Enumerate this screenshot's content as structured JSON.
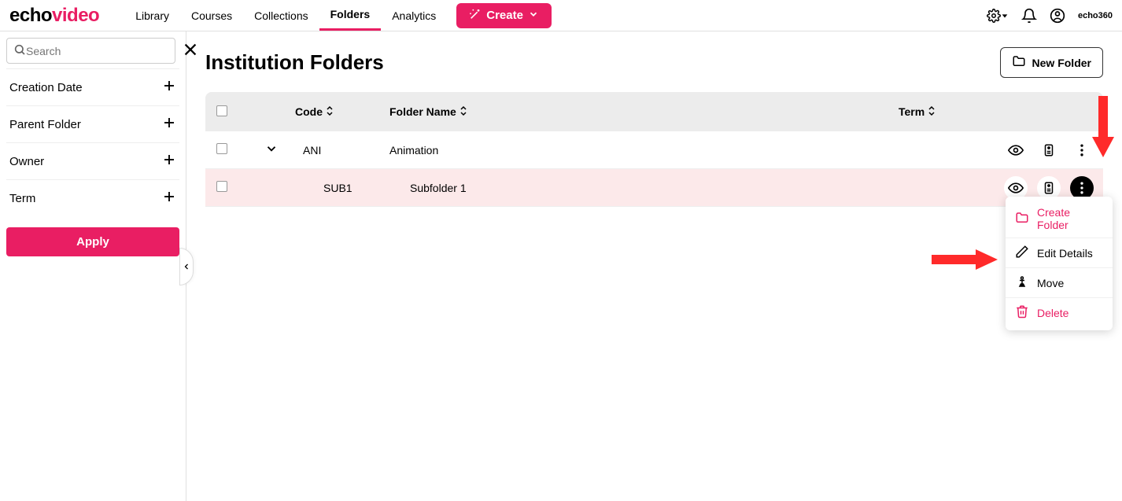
{
  "logo": {
    "echo": "echo",
    "video": "video"
  },
  "nav": {
    "items": [
      {
        "label": "Library"
      },
      {
        "label": "Courses"
      },
      {
        "label": "Collections"
      },
      {
        "label": "Folders"
      },
      {
        "label": "Analytics"
      }
    ],
    "create_label": "Create"
  },
  "header_brand": "echo360",
  "sidebar": {
    "search_placeholder": "Search",
    "filters": [
      {
        "label": "Creation Date"
      },
      {
        "label": "Parent Folder"
      },
      {
        "label": "Owner"
      },
      {
        "label": "Term"
      }
    ],
    "apply_label": "Apply"
  },
  "main": {
    "title": "Institution Folders",
    "new_folder_label": "New Folder",
    "columns": {
      "code": "Code",
      "folder_name": "Folder Name",
      "term": "Term"
    },
    "rows": [
      {
        "code": "ANI",
        "name": "Animation",
        "term": ""
      },
      {
        "code": "SUB1",
        "name": "Subfolder 1",
        "term": ""
      }
    ]
  },
  "context_menu": {
    "create_folder": "Create Folder",
    "edit_details": "Edit Details",
    "move": "Move",
    "delete": "Delete"
  }
}
